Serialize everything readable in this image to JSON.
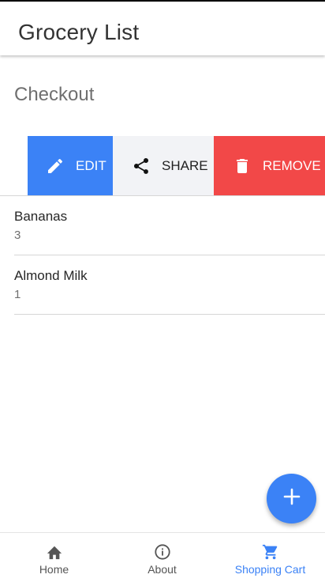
{
  "header": {
    "title": "Grocery List"
  },
  "section": {
    "title": "Checkout"
  },
  "swipe_actions": {
    "edit_label": "EDIT",
    "share_label": "SHARE",
    "remove_label": "REMOVE"
  },
  "items": [
    {
      "name": "Bananas",
      "quantity": "3"
    },
    {
      "name": "Almond Milk",
      "quantity": "1"
    }
  ],
  "nav": {
    "home_label": "Home",
    "about_label": "About",
    "cart_label": "Shopping Cart",
    "active": "cart"
  },
  "icons": {
    "edit": "pencil-icon",
    "share": "share-icon",
    "remove": "trash-icon",
    "fab": "plus-icon",
    "home": "home-icon",
    "about": "info-icon",
    "cart": "cart-icon"
  },
  "colors": {
    "primary": "#3b82f6",
    "danger": "#f24848",
    "share_bg": "#f2f3f6",
    "muted_text": "#6f6f6f"
  }
}
